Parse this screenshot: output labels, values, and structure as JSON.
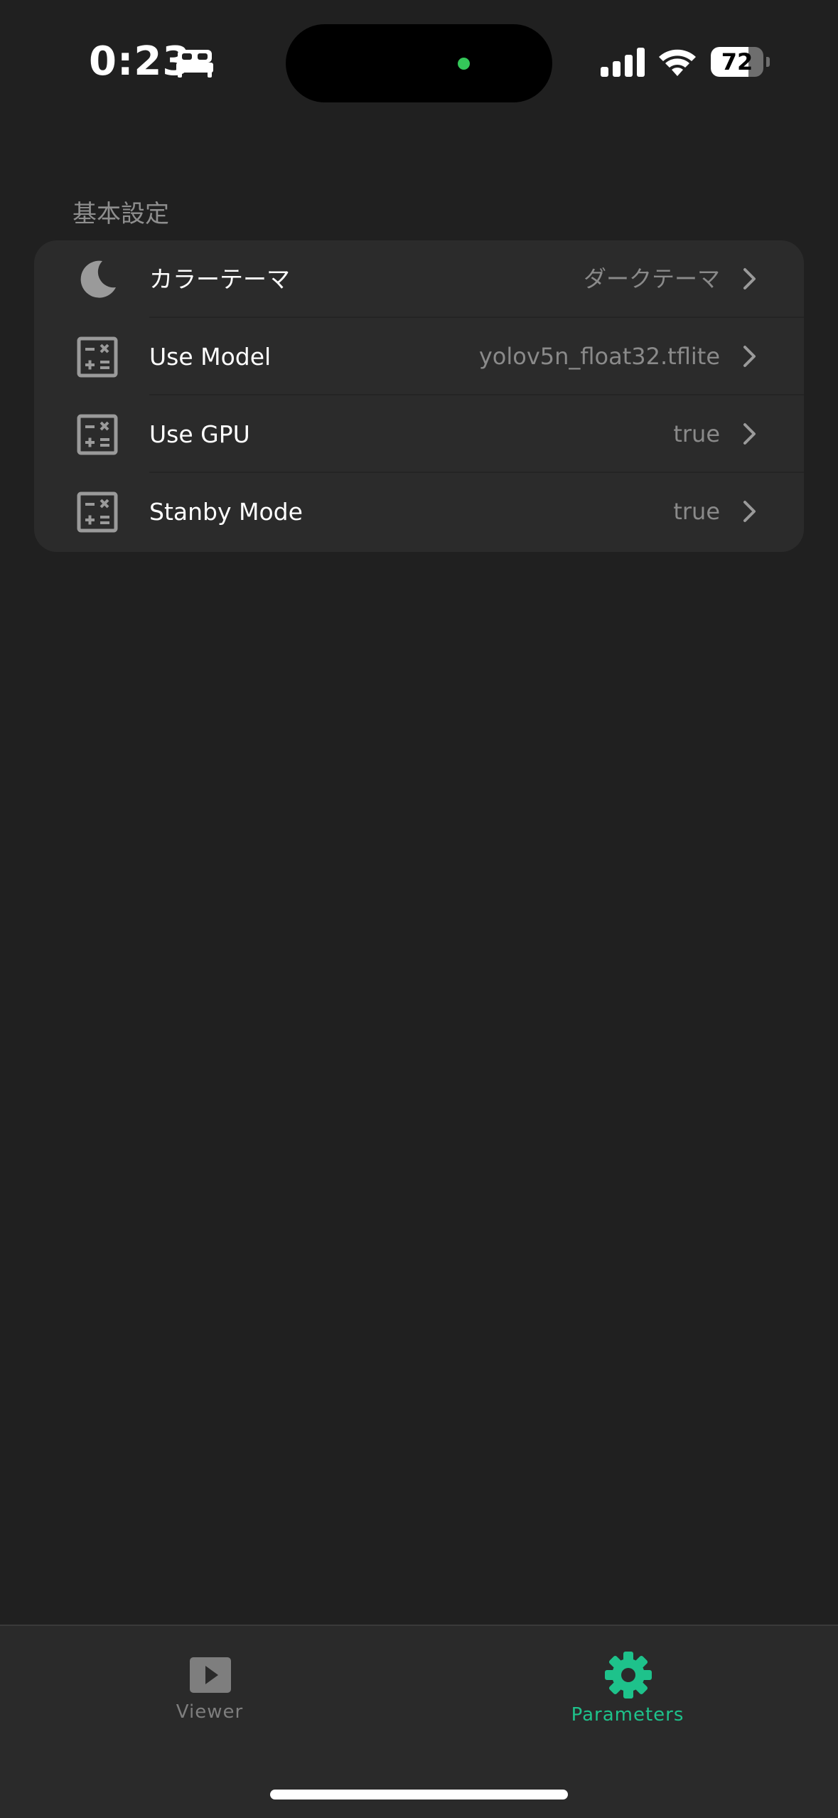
{
  "status_bar": {
    "time": "0:23",
    "battery_level": "72",
    "battery_fraction": 0.72,
    "focus_icon": "bed-icon",
    "indicator_color": "#34c759"
  },
  "settings": {
    "section_title": "基本設定",
    "rows": [
      {
        "icon": "moon-icon",
        "label": "カラーテーマ",
        "value": "ダークテーマ"
      },
      {
        "icon": "calculator-icon",
        "label": "Use Model",
        "value": "yolov5n_float32.tflite"
      },
      {
        "icon": "calculator-icon",
        "label": "Use GPU",
        "value": "true"
      },
      {
        "icon": "calculator-icon",
        "label": "Stanby Mode",
        "value": "true"
      }
    ]
  },
  "tab_bar": {
    "tabs": [
      {
        "icon": "play-icon",
        "label": "Viewer",
        "active": false
      },
      {
        "icon": "gear-icon",
        "label": "Parameters",
        "active": true
      }
    ],
    "active_color": "#1ec28b",
    "inactive_color": "#7e7e7e"
  },
  "colors": {
    "background": "#202020",
    "group_background": "#2b2b2b",
    "secondary_text": "#8a8a8a"
  }
}
